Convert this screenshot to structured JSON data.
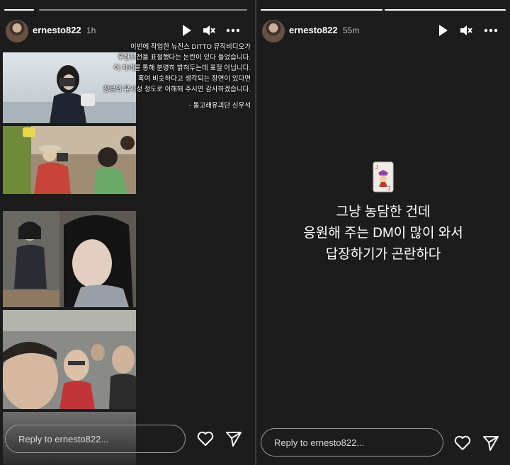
{
  "left_story": {
    "progress": [
      1,
      0,
      0
    ],
    "username": "ernesto822",
    "time": "1h",
    "icons": {
      "play": "play-icon",
      "mute": "mute-icon",
      "more": "more-icon"
    },
    "caption_lines": [
      "이번에 작업한 뉴진스 DITTO 뮤직비디오가",
      "무한도전을 표절했다는 논란이 있다 들었습니다.",
      "이 자리를 통해 분명히 밝혀두는데 표절 아닙니다.",
      "혹여 비슷하다고 생각되는 장면이 있다면",
      "장르의 유사성 정도로 이해해 주시면 감사하겠습니다."
    ],
    "credit": "- 돌고래유괴단 신우석",
    "reply_placeholder": "Reply to ernesto822..."
  },
  "right_story": {
    "progress": [
      1,
      1
    ],
    "username": "ernesto822",
    "time": "55m",
    "icons": {
      "play": "play-icon",
      "mute": "mute-icon",
      "more": "more-icon",
      "card": "joker-card-icon"
    },
    "message_lines": [
      "그냥 농담한 건데",
      "응원해 주는 DM이 많이 와서",
      "답장하기가 곤란하다"
    ],
    "reply_placeholder": "Reply to ernesto822..."
  }
}
